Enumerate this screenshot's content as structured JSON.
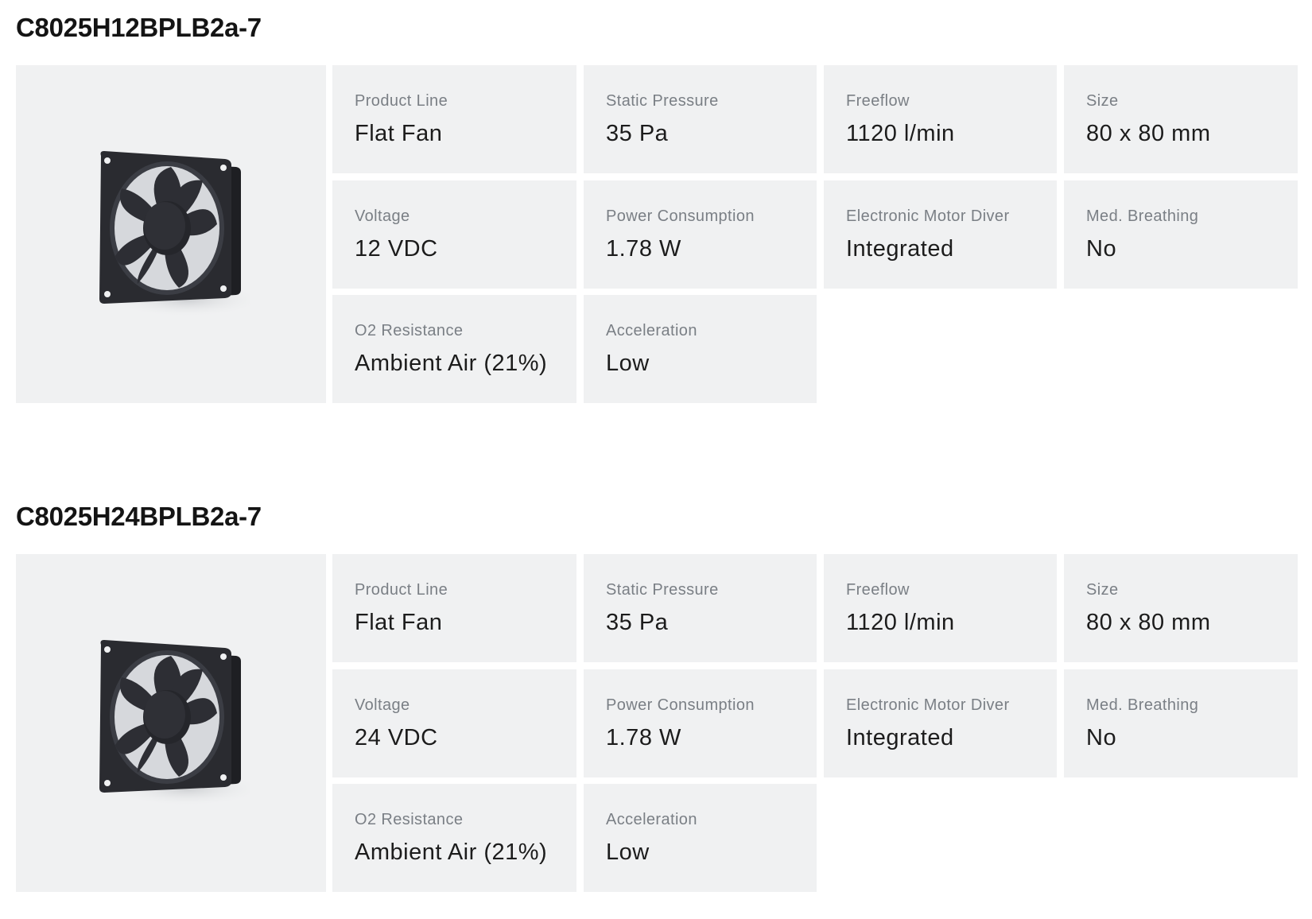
{
  "products": [
    {
      "title": "C8025H12BPLB2a-7",
      "image_icon": "axial-fan-icon",
      "specs": {
        "product_line": {
          "label": "Product Line",
          "value": "Flat Fan"
        },
        "static_pressure": {
          "label": "Static Pressure",
          "value": "35 Pa"
        },
        "freeflow": {
          "label": "Freeflow",
          "value": "1120 l/min"
        },
        "size": {
          "label": "Size",
          "value": "80 x 80 mm"
        },
        "voltage": {
          "label": "Voltage",
          "value": "12 VDC"
        },
        "power_consumption": {
          "label": "Power Consumption",
          "value": "1.78 W"
        },
        "motor_driver": {
          "label": "Electronic Motor Diver",
          "value": "Integrated"
        },
        "med_breathing": {
          "label": "Med. Breathing",
          "value": "No"
        },
        "o2_resistance": {
          "label": "O2 Resistance",
          "value": "Ambient Air (21%)"
        },
        "acceleration": {
          "label": "Acceleration",
          "value": "Low"
        }
      }
    },
    {
      "title": "C8025H24BPLB2a-7",
      "image_icon": "axial-fan-icon",
      "specs": {
        "product_line": {
          "label": "Product Line",
          "value": "Flat Fan"
        },
        "static_pressure": {
          "label": "Static Pressure",
          "value": "35 Pa"
        },
        "freeflow": {
          "label": "Freeflow",
          "value": "1120 l/min"
        },
        "size": {
          "label": "Size",
          "value": "80 x 80 mm"
        },
        "voltage": {
          "label": "Voltage",
          "value": "24 VDC"
        },
        "power_consumption": {
          "label": "Power Consumption",
          "value": "1.78 W"
        },
        "motor_driver": {
          "label": "Electronic Motor Diver",
          "value": "Integrated"
        },
        "med_breathing": {
          "label": "Med. Breathing",
          "value": "No"
        },
        "o2_resistance": {
          "label": "O2 Resistance",
          "value": "Ambient Air (21%)"
        },
        "acceleration": {
          "label": "Acceleration",
          "value": "Low"
        }
      }
    }
  ],
  "colors": {
    "cell_background": "#f0f1f2",
    "label_text": "#7a7f85",
    "value_text": "#1c1c1c",
    "title_text": "#141414",
    "fan_body": "#26272c"
  }
}
